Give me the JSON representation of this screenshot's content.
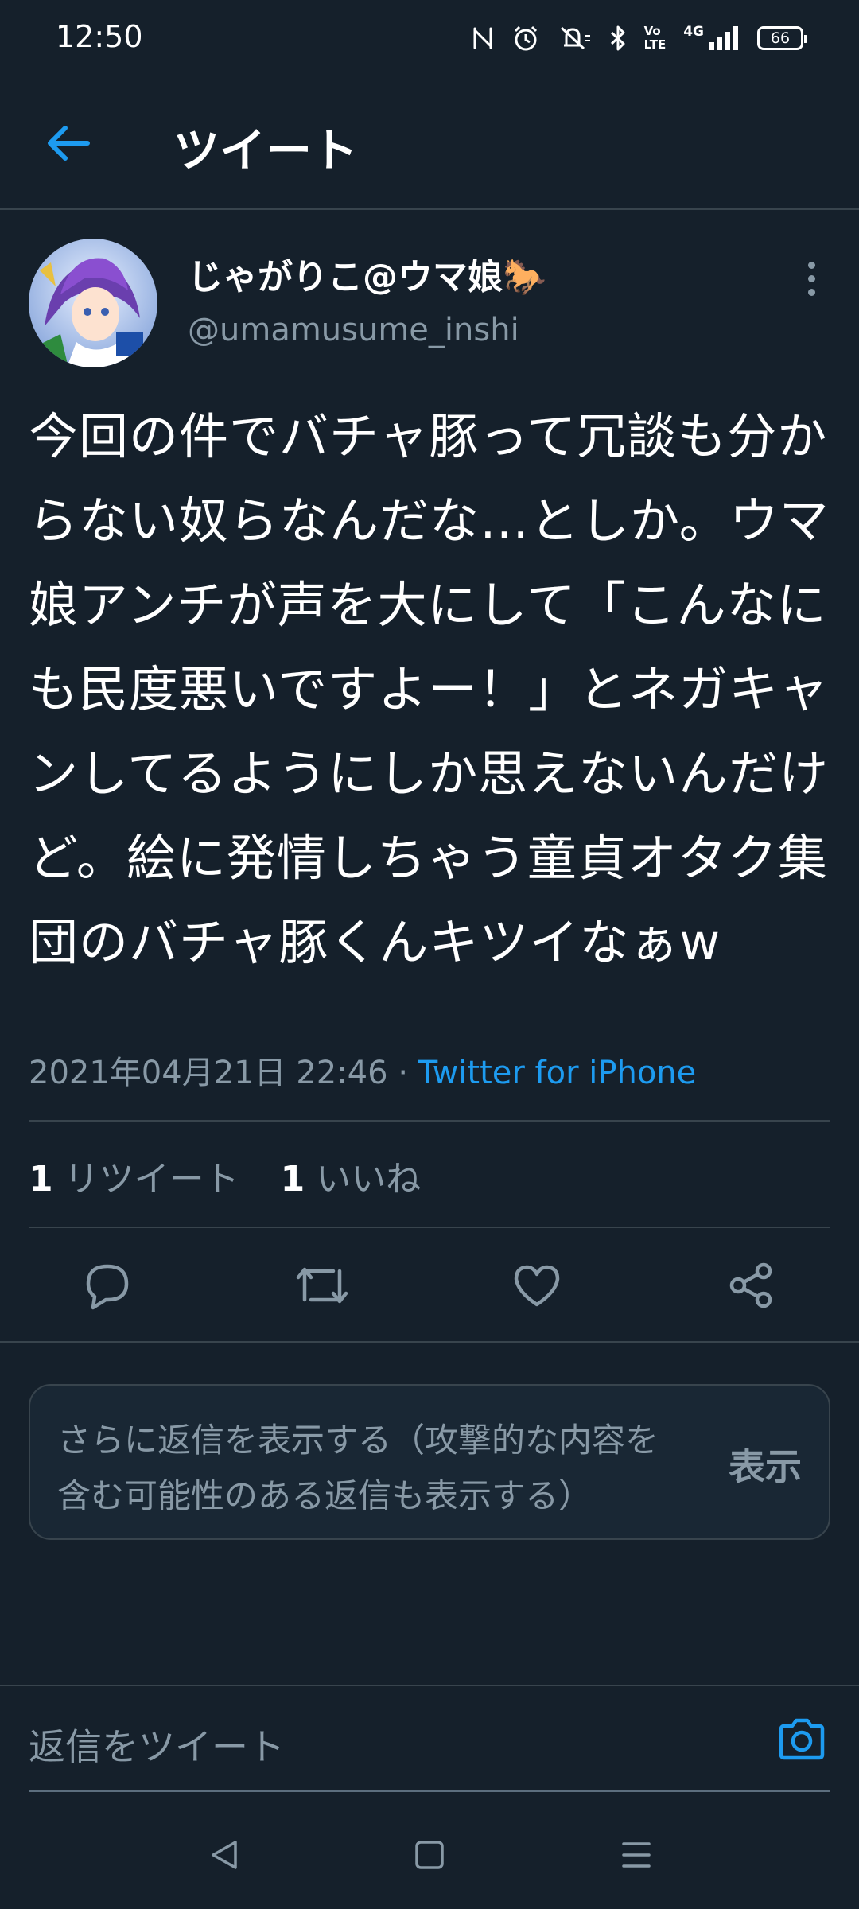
{
  "status_bar": {
    "time": "12:50",
    "network": "4G",
    "volte": "Vo LTE",
    "battery": "66",
    "icons": [
      "nfc-icon",
      "alarm-icon",
      "mute-icon",
      "bluetooth-icon",
      "volte-icon",
      "signal-icon",
      "battery-icon"
    ]
  },
  "header": {
    "title": "ツイート",
    "back_icon": "arrow-left-icon",
    "accent_color": "#1d9bf0"
  },
  "tweet": {
    "author_name": "じゃがりこ@ウマ娘🐎",
    "author_handle": "@umamusume_inshi",
    "text": "今回の件でバチャ豚って冗談も分からない奴らなんだな…としか。ウマ娘アンチが声を大にして「こんなにも民度悪いですよー！」とネガキャンしてるようにしか思えないんだけど。絵に発情しちゃう童貞オタク集団のバチャ豚くんキツイなぁw",
    "date": "2021年04月21日 22:46",
    "separator": "·",
    "source": "Twitter for iPhone",
    "retweet_count": "1",
    "retweet_label": "リツイート",
    "like_count": "1",
    "like_label": "いいね"
  },
  "actions": [
    "reply-icon",
    "retweet-icon",
    "like-icon",
    "share-icon"
  ],
  "more_replies": {
    "text": "さらに返信を表示する（攻撃的な内容を含む可能性のある返信も表示する）",
    "button": "表示"
  },
  "reply": {
    "placeholder": "返信をツイート",
    "camera_icon": "camera-icon"
  },
  "nav": [
    "back-triangle-icon",
    "home-square-icon",
    "menu-lines-icon"
  ]
}
